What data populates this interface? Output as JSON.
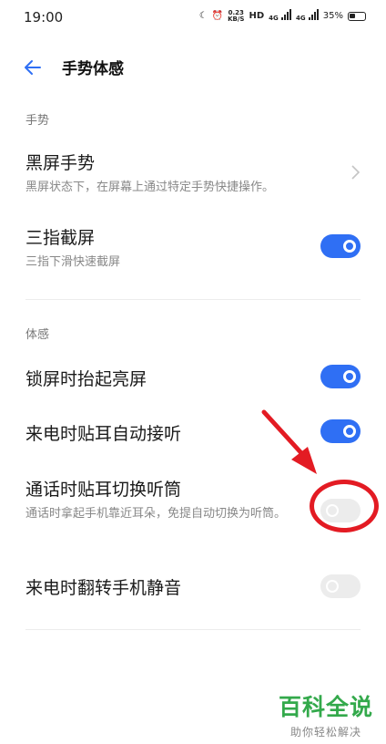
{
  "status_bar": {
    "time": "19:00",
    "net_speed_value": "0.23",
    "net_speed_unit": "KB/S",
    "hd_label": "HD",
    "sim1_label": "4G",
    "sim2_label": "4G",
    "battery_text": "35%"
  },
  "header": {
    "title": "手势体感"
  },
  "sections": {
    "gestures": {
      "label": "手势",
      "screen_off_gesture": {
        "title": "黑屏手势",
        "subtitle": "黑屏状态下，在屏幕上通过特定手势快捷操作。"
      },
      "three_finger_screenshot": {
        "title": "三指截屏",
        "subtitle": "三指下滑快速截屏",
        "enabled": true
      }
    },
    "motion": {
      "label": "体感",
      "raise_to_wake": {
        "title": "锁屏时抬起亮屏",
        "enabled": true
      },
      "auto_answer": {
        "title": "来电时贴耳自动接听",
        "enabled": true
      },
      "switch_to_earpiece": {
        "title": "通话时贴耳切换听筒",
        "subtitle": "通话时拿起手机靠近耳朵，免提自动切换为听筒。",
        "enabled": false
      },
      "flip_to_mute": {
        "title": "来电时翻转手机静音",
        "enabled": false
      }
    }
  },
  "watermark": {
    "logo": "百科全说",
    "slogan": "助你轻松解决"
  },
  "colors": {
    "toggle_on": "#2f6ff4",
    "toggle_off": "#ececec",
    "annotation_red": "#e31b23",
    "watermark_green": "#33a94b",
    "back_arrow": "#2f6ff4"
  }
}
